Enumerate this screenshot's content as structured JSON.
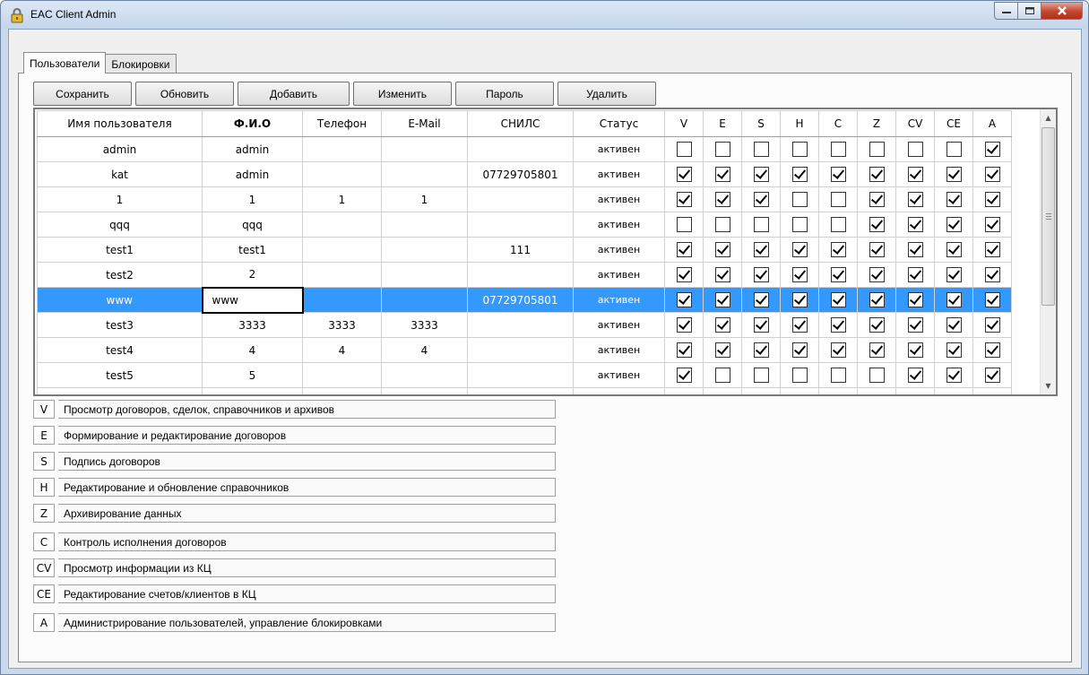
{
  "window": {
    "title": "EAC Client Admin",
    "controls": {
      "minimize": "—",
      "maximize": "□",
      "close": "X"
    }
  },
  "tabs": [
    {
      "label": "Пользователи",
      "active": true
    },
    {
      "label": "Блокировки",
      "active": false
    }
  ],
  "toolbar": {
    "save_label": "Сохранить",
    "refresh_label": "Обновить",
    "add_label": "Добавить",
    "edit_label": "Изменить",
    "password_label": "Пароль",
    "delete_label": "Удалить"
  },
  "grid": {
    "columns": [
      "Имя пользователя",
      "Ф.И.О",
      "Телефон",
      "E-Mail",
      "СНИЛС",
      "Статус",
      "V",
      "E",
      "S",
      "H",
      "C",
      "Z",
      "CV",
      "CE",
      "A"
    ],
    "sorted_column": "Ф.И.О",
    "rows": [
      {
        "username": "admin",
        "fio": "admin",
        "phone": "",
        "email": "",
        "snils": "",
        "status": "активен",
        "perms": [
          false,
          false,
          false,
          false,
          false,
          false,
          false,
          false,
          true
        ]
      },
      {
        "username": "kat",
        "fio": "admin",
        "phone": "",
        "email": "",
        "snils": "07729705801",
        "status": "активен",
        "perms": [
          true,
          true,
          true,
          true,
          true,
          true,
          true,
          true,
          true
        ]
      },
      {
        "username": "1",
        "fio": "1",
        "phone": "1",
        "email": "1",
        "snils": "",
        "status": "активен",
        "perms": [
          true,
          true,
          true,
          false,
          false,
          true,
          true,
          true,
          true
        ]
      },
      {
        "username": "qqq",
        "fio": "qqq",
        "phone": "",
        "email": "",
        "snils": "",
        "status": "активен",
        "perms": [
          false,
          false,
          false,
          false,
          false,
          true,
          true,
          true,
          true
        ]
      },
      {
        "username": "test1",
        "fio": "test1",
        "phone": "",
        "email": "",
        "snils": "111",
        "status": "активен",
        "perms": [
          true,
          true,
          true,
          true,
          true,
          true,
          true,
          true,
          true
        ]
      },
      {
        "username": "test2",
        "fio": "2",
        "phone": "",
        "email": "",
        "snils": "",
        "status": "активен",
        "perms": [
          true,
          true,
          true,
          true,
          true,
          true,
          true,
          true,
          true
        ]
      },
      {
        "username": "www",
        "fio": "www",
        "phone": "",
        "email": "",
        "snils": "07729705801",
        "status": "активен",
        "perms": [
          true,
          true,
          true,
          true,
          true,
          true,
          true,
          true,
          true
        ],
        "selected": true
      },
      {
        "username": "test3",
        "fio": "3333",
        "phone": "3333",
        "email": "3333",
        "snils": "",
        "status": "активен",
        "perms": [
          true,
          true,
          true,
          true,
          true,
          true,
          true,
          true,
          true
        ]
      },
      {
        "username": "test4",
        "fio": "4",
        "phone": "4",
        "email": "4",
        "snils": "",
        "status": "активен",
        "perms": [
          true,
          true,
          true,
          true,
          true,
          true,
          true,
          true,
          true
        ]
      },
      {
        "username": "test5",
        "fio": "5",
        "phone": "",
        "email": "",
        "snils": "",
        "status": "активен",
        "perms": [
          true,
          false,
          false,
          false,
          false,
          false,
          true,
          true,
          true
        ]
      }
    ]
  },
  "legend": [
    {
      "code": "V",
      "desc": "Просмотр  договоров, сделок,  справочников и архивов"
    },
    {
      "code": "E",
      "desc": "Формирование и редактирование договоров"
    },
    {
      "code": "S",
      "desc": "Подпись договоров"
    },
    {
      "code": "H",
      "desc": "Редактирование и обновление справочников"
    },
    {
      "code": "Z",
      "desc": "Архивирование данных"
    },
    {
      "code": "C",
      "desc": "Контроль исполнения договоров"
    },
    {
      "code": "CV",
      "desc": "Просмотр информации из КЦ"
    },
    {
      "code": "CE",
      "desc": "Редактирование счетов/клиентов в КЦ"
    },
    {
      "code": "A",
      "desc": "Администрирование пользователей, управление блокировками"
    }
  ],
  "colors": {
    "selection": "#3399ff",
    "window_frame": "#c9d8eb",
    "close_button": "#c2452e"
  }
}
